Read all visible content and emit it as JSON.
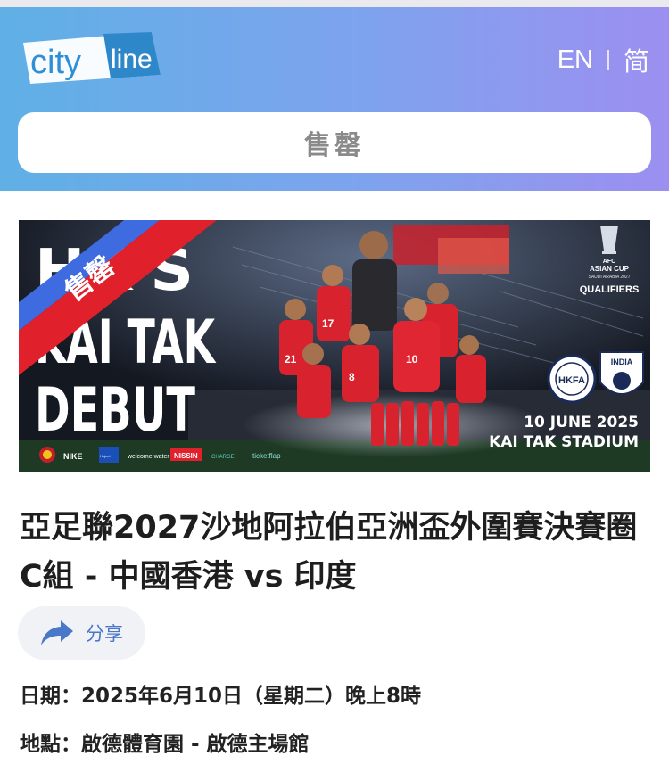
{
  "header": {
    "logo_text_left": "city",
    "logo_text_right": "line",
    "lang_en": "EN",
    "lang_sc": "简",
    "status_label": "售罄"
  },
  "banner": {
    "ribbon": "售罄",
    "headline_line1": "HK'S",
    "headline_line2": "KAI TAK",
    "headline_line3": "DEBUT",
    "cup_line1": "AFC",
    "cup_line2": "ASIAN CUP",
    "cup_line3": "SAUDI ARABIA 2027",
    "cup_line4": "QUALIFIERS",
    "crest_left": "HKFA",
    "crest_right": "INDIA",
    "date": "10 JUNE 2025",
    "venue": "KAI TAK STADIUM",
    "sponsors": [
      "NIKE",
      "Hirjeet",
      "welcome water",
      "NISSIN",
      "CHARGE",
      "ticketflap"
    ],
    "player_numbers": [
      "17",
      "21",
      "10",
      "8"
    ]
  },
  "event": {
    "title": "亞足聯2027沙地阿拉伯亞洲盃外圍賽決賽圈 C組 - 中國香港 vs 印度",
    "share_label": "分享",
    "date_key": "日期：",
    "date_value": "2025年6月10日（星期二）晚上8時",
    "venue_key": "地點：",
    "venue_value": "啟德體育園 - 啟德主場館"
  },
  "colors": {
    "header_gradient_start": "#5fb0e6",
    "header_gradient_end": "#9c8ff0",
    "ribbon_red": "#e0202b",
    "ribbon_blue": "#3f6be0",
    "share_accent": "#4a78c8"
  }
}
